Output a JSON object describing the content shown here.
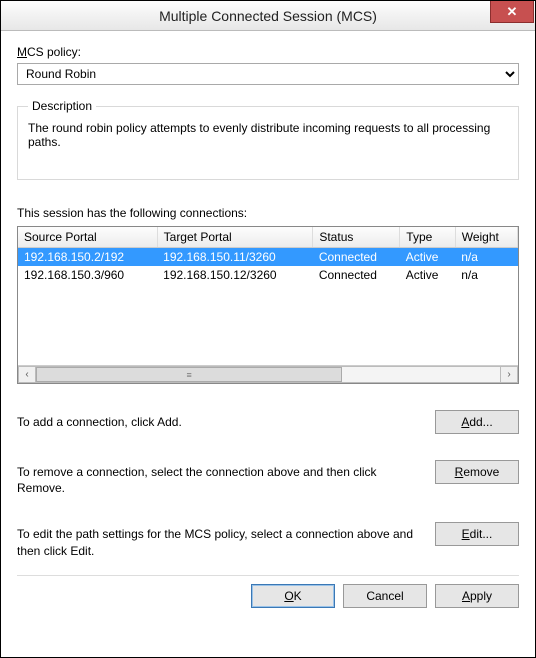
{
  "window": {
    "title": "Multiple Connected Session (MCS)",
    "close_symbol": "✕"
  },
  "policy": {
    "label_prefix": "M",
    "label_rest": "CS policy:",
    "selected": "Round Robin"
  },
  "description": {
    "legend": "Description",
    "text": "The round robin policy attempts to evenly distribute incoming requests to all processing paths."
  },
  "connections": {
    "label": "This session has the following connections:",
    "headers": {
      "source": "Source Portal",
      "target": "Target Portal",
      "status": "Status",
      "type": "Type",
      "weight": "Weight"
    },
    "rows": [
      {
        "source": "192.168.150.2/192",
        "target": "192.168.150.11/3260",
        "status": "Connected",
        "type": "Active",
        "weight": "n/a",
        "selected": true
      },
      {
        "source": "192.168.150.3/960",
        "target": "192.168.150.12/3260",
        "status": "Connected",
        "type": "Active",
        "weight": "n/a",
        "selected": false
      }
    ]
  },
  "actions": {
    "add_text": "To add a connection, click Add.",
    "add_prefix": "A",
    "add_rest": "dd...",
    "remove_text": "To remove a connection, select the connection above and then click Remove.",
    "remove_prefix": "R",
    "remove_rest": "emove",
    "edit_text": "To edit the path settings for the MCS policy, select a connection above and then click Edit.",
    "edit_prefix": "E",
    "edit_rest": "dit..."
  },
  "footer": {
    "ok_prefix": "O",
    "ok_rest": "K",
    "cancel": "Cancel",
    "apply_prefix": "A",
    "apply_rest": "pply"
  }
}
